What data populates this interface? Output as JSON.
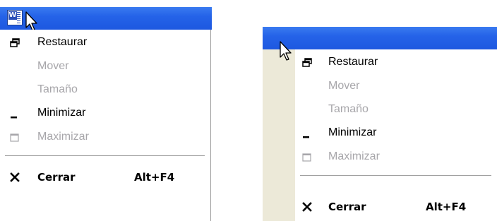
{
  "colors": {
    "titlebar": "#2563e8",
    "disabled_text": "#a7a6aa",
    "window_face": "#ece9d8",
    "separator": "#a0a0a0"
  },
  "left_menu": {
    "app_icon": "word-document-icon",
    "items": [
      {
        "label": "Restaurar",
        "icon": "restore-icon",
        "enabled": true
      },
      {
        "label": "Mover",
        "icon": "",
        "enabled": false
      },
      {
        "label": "Tamaño",
        "icon": "",
        "enabled": false
      },
      {
        "label": "Minimizar",
        "icon": "minimize-icon",
        "enabled": true
      },
      {
        "label": "Maximizar",
        "icon": "maximize-icon",
        "enabled": false
      },
      {
        "label": "Cerrar",
        "icon": "close-icon",
        "enabled": true,
        "accelerator": "Alt+F4"
      }
    ]
  },
  "right_menu": {
    "items": [
      {
        "label": "Restaurar",
        "icon": "restore-icon",
        "enabled": true
      },
      {
        "label": "Mover",
        "icon": "",
        "enabled": false
      },
      {
        "label": "Tamaño",
        "icon": "",
        "enabled": false
      },
      {
        "label": "Minimizar",
        "icon": "minimize-icon",
        "enabled": true
      },
      {
        "label": "Maximizar",
        "icon": "maximize-icon",
        "enabled": false
      },
      {
        "label": "Cerrar",
        "icon": "close-icon",
        "enabled": true,
        "accelerator": "Alt+F4"
      }
    ]
  }
}
